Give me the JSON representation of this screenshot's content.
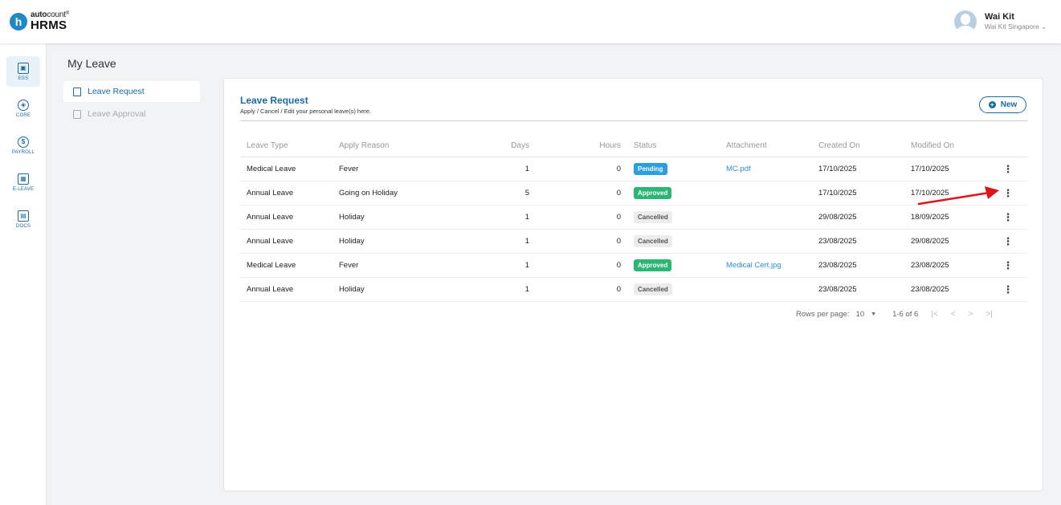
{
  "app": {
    "logo_letter": "h",
    "logo_small_bold": "auto",
    "logo_small_regular": "count",
    "logo_small_mark": "®",
    "logo_big": "HRMS"
  },
  "user": {
    "name": "Wai Kit",
    "company": "Wai Kit Singapore",
    "dropdown_glyph": "⌄"
  },
  "sidebar": {
    "items": [
      {
        "label": "ESS",
        "icon": "ess-icon",
        "active": true
      },
      {
        "label": "CORE",
        "icon": "core-icon"
      },
      {
        "label": "PAYROLL",
        "icon": "payroll-icon"
      },
      {
        "label": "E-LEAVE",
        "icon": "calendar-icon"
      },
      {
        "label": "DOCS",
        "icon": "docs-icon"
      }
    ]
  },
  "page": {
    "title": "My Leave"
  },
  "submenu": {
    "items": [
      {
        "label": "Leave Request",
        "active": true
      },
      {
        "label": "Leave Approval",
        "active": false
      }
    ]
  },
  "card": {
    "title": "Leave Request",
    "subtitle": "Apply / Cancel / Edit your personal leave(s) here.",
    "new_button": "New"
  },
  "table": {
    "headers": [
      "Leave Type",
      "Apply Reason",
      "Days",
      "Hours",
      "Status",
      "Attachment",
      "Created On",
      "Modified On"
    ],
    "rows": [
      {
        "leave_type": "Medical Leave",
        "reason": "Fever",
        "days": "1",
        "hours": "0",
        "status": "Pending",
        "attachment": "MC.pdf",
        "created": "17/10/2025",
        "modified": "17/10/2025"
      },
      {
        "leave_type": "Annual Leave",
        "reason": "Going on Holiday",
        "days": "5",
        "hours": "0",
        "status": "Approved",
        "attachment": "",
        "created": "17/10/2025",
        "modified": "17/10/2025"
      },
      {
        "leave_type": "Annual Leave",
        "reason": "Holiday",
        "days": "1",
        "hours": "0",
        "status": "Cancelled",
        "attachment": "",
        "created": "29/08/2025",
        "modified": "18/09/2025"
      },
      {
        "leave_type": "Annual Leave",
        "reason": "Holiday",
        "days": "1",
        "hours": "0",
        "status": "Cancelled",
        "attachment": "",
        "created": "23/08/2025",
        "modified": "29/08/2025"
      },
      {
        "leave_type": "Medical Leave",
        "reason": "Fever",
        "days": "1",
        "hours": "0",
        "status": "Approved",
        "attachment": "Medical Cert.jpg",
        "created": "23/08/2025",
        "modified": "23/08/2025"
      },
      {
        "leave_type": "Annual Leave",
        "reason": "Holiday",
        "days": "1",
        "hours": "0",
        "status": "Cancelled",
        "attachment": "",
        "created": "23/08/2025",
        "modified": "23/08/2025"
      }
    ],
    "row_menu_glyph": "⋮"
  },
  "pagination": {
    "rows_per_page_label": "Rows per page:",
    "rows_per_page_value": "10",
    "range": "1-6 of 6",
    "first": "|<",
    "prev": "<",
    "next": ">",
    "last": ">|"
  },
  "colors": {
    "accent": "#1a6aa3",
    "pending": "#2a9fe3",
    "approved": "#2bb673",
    "cancelled": "#ececec",
    "annotation_arrow": "#e0141b"
  }
}
